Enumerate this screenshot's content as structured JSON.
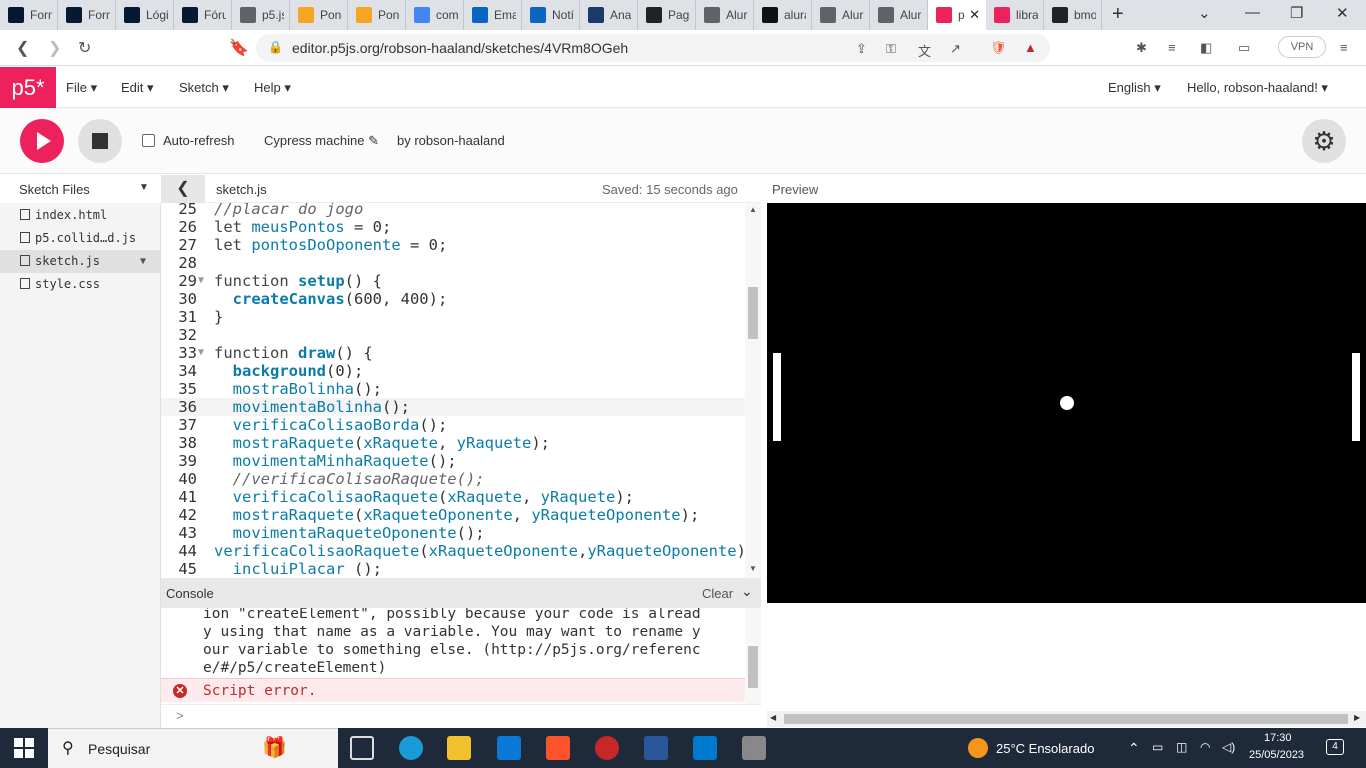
{
  "browser": {
    "tabs": [
      {
        "label": "Form",
        "icon": "alura-icon",
        "color": "#051933"
      },
      {
        "label": "Form",
        "icon": "alura-icon",
        "color": "#051933"
      },
      {
        "label": "Lógi",
        "icon": "alura-icon",
        "color": "#051933"
      },
      {
        "label": "Fóru",
        "icon": "alura-icon",
        "color": "#051933"
      },
      {
        "label": "p5.js",
        "icon": "globe-icon",
        "color": "#5f6368"
      },
      {
        "label": "Pong",
        "icon": "pong-icon",
        "color": "#f5a623"
      },
      {
        "label": "Pong",
        "icon": "pong-icon",
        "color": "#f5a623"
      },
      {
        "label": "com",
        "icon": "google-icon",
        "color": "#4285f4"
      },
      {
        "label": "Emai",
        "icon": "outlook-icon",
        "color": "#0a66c2"
      },
      {
        "label": "Notí",
        "icon": "linkedin-icon",
        "color": "#0a66c2"
      },
      {
        "label": "Anal",
        "icon": "square-icon",
        "color": "#1a3a6a"
      },
      {
        "label": "Page",
        "icon": "github-icon",
        "color": "#222"
      },
      {
        "label": "Alura",
        "icon": "globe-icon",
        "color": "#5f6368"
      },
      {
        "label": "alura",
        "icon": "triangle-icon",
        "color": "#111"
      },
      {
        "label": "Alura",
        "icon": "globe-icon",
        "color": "#5f6368"
      },
      {
        "label": "Alura",
        "icon": "globe-icon",
        "color": "#5f6368"
      },
      {
        "label": "p",
        "icon": "p5-asterisk-icon",
        "color": "#ed225d",
        "active": true
      },
      {
        "label": "libra",
        "icon": "p5-asterisk-icon",
        "color": "#ed225d"
      },
      {
        "label": "bmo",
        "icon": "github-icon",
        "color": "#222"
      }
    ],
    "url": "editor.p5js.org/robson-haaland/sketches/4VRm8OGeh",
    "vpn_label": "VPN"
  },
  "app": {
    "logo": "p5*",
    "menus": [
      "File",
      "Edit",
      "Sketch",
      "Help"
    ],
    "language": "English",
    "greeting": "Hello, robson-haaland!",
    "auto_refresh_label": "Auto-refresh",
    "auto_refresh_checked": false,
    "sketch_name": "Cypress machine",
    "author": "by robson-haaland"
  },
  "sidebar": {
    "title": "Sketch Files",
    "files": [
      {
        "name": "index.html",
        "selected": false
      },
      {
        "name": "p5.collid…d.js",
        "selected": false
      },
      {
        "name": "sketch.js",
        "selected": true
      },
      {
        "name": "style.css",
        "selected": false
      }
    ]
  },
  "editor": {
    "filename": "sketch.js",
    "saved_status": "Saved: 15 seconds ago",
    "highlighted_line": 36,
    "lines": [
      {
        "n": "25",
        "t": "//placar do jogo"
      },
      {
        "n": "26",
        "t": "let meusPontos = 0;"
      },
      {
        "n": "27",
        "t": "let pontosDoOponente = 0;"
      },
      {
        "n": "28",
        "t": ""
      },
      {
        "n": "29",
        "t": "function setup() {",
        "fold": true
      },
      {
        "n": "30",
        "t": "  createCanvas(600, 400);"
      },
      {
        "n": "31",
        "t": "}"
      },
      {
        "n": "32",
        "t": ""
      },
      {
        "n": "33",
        "t": "function draw() {",
        "fold": true
      },
      {
        "n": "34",
        "t": "  background(0);"
      },
      {
        "n": "35",
        "t": "  mostraBolinha();"
      },
      {
        "n": "36",
        "t": "  movimentaBolinha();"
      },
      {
        "n": "37",
        "t": "  verificaColisaoBorda();"
      },
      {
        "n": "38",
        "t": "  mostraRaquete(xRaquete, yRaquete);"
      },
      {
        "n": "39",
        "t": "  movimentaMinhaRaquete();"
      },
      {
        "n": "40",
        "t": "  //verificaColisaoRaquete();"
      },
      {
        "n": "41",
        "t": "  verificaColisaoRaquete(xRaquete, yRaquete);"
      },
      {
        "n": "42",
        "t": "  mostraRaquete(xRaqueteOponente, yRaqueteOponente);"
      },
      {
        "n": "43",
        "t": "  movimentaRaqueteOponente();"
      },
      {
        "n": "44",
        "t": "verificaColisaoRaquete(xRaqueteOponente,yRaqueteOponente);"
      },
      {
        "n": "45",
        "t": "  incluiPlacar ();"
      }
    ]
  },
  "console": {
    "title": "Console",
    "clear_label": "Clear",
    "message_lines": [
      "ion \"createElement\", possibly because your code is alread",
      "y using that name as a variable. You may want to rename y",
      "our variable to something else. (http://p5js.org/referenc",
      "e/#/p5/createElement)"
    ],
    "error": "Script error.",
    "prompt": ">"
  },
  "preview": {
    "title": "Preview",
    "canvas_bg": "#000000"
  },
  "taskbar": {
    "search_label": "Pesquisar",
    "weather": "25°C  Ensolarado",
    "time": "17:30",
    "date": "25/05/2023",
    "notifications": "4"
  },
  "colors": {
    "p5_pink": "#ed225d",
    "code_blue": "#0b7ca9",
    "error_red": "#c62828"
  }
}
